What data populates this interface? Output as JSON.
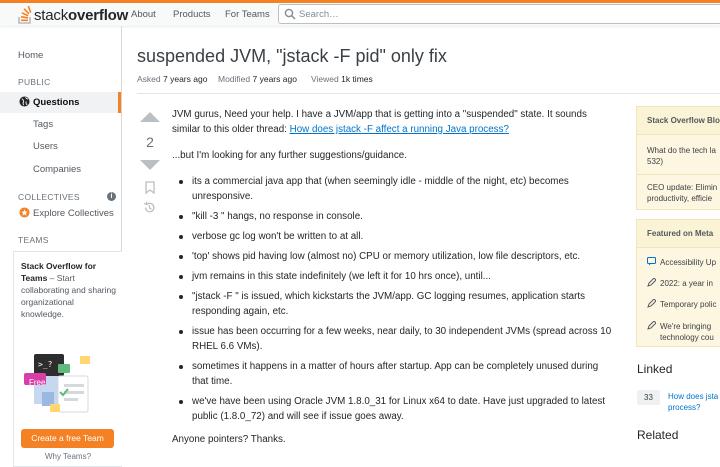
{
  "header": {
    "logo_plain": "stack",
    "logo_bold": "overflow",
    "nav": [
      "About",
      "Products",
      "For Teams"
    ],
    "search_placeholder": "Search…"
  },
  "sidebar": {
    "home": "Home",
    "public_heading": "PUBLIC",
    "questions": "Questions",
    "tags": "Tags",
    "users": "Users",
    "companies": "Companies",
    "collectives_heading": "COLLECTIVES",
    "explore_collectives": "Explore Collectives",
    "teams_heading": "TEAMS",
    "teams_card": {
      "title": "Stack Overflow for Teams",
      "desc": " – Start collaborating and sharing organizational knowledge.",
      "badge": "Free",
      "button": "Create a free Team",
      "why": "Why Teams?"
    }
  },
  "question": {
    "title": "suspended JVM, \"jstack -F pid\" only fix",
    "asked_label": "Asked",
    "asked_value": "7 years ago",
    "modified_label": "Modified",
    "modified_value": "7 years ago",
    "viewed_label": "Viewed",
    "viewed_value": "1k times",
    "votes": "2",
    "intro": "JVM gurus, Need your help. I have a JVM/app that is getting into a \"suspended\" state. It sounds similar to this older thread: ",
    "intro_link": "How does jstack -F affect a running Java process?",
    "followup": "...but I'm looking for any further suggestions/guidance.",
    "bullets": [
      "its a commercial java app that (when seemingly idle - middle of the night, etc) becomes unresponsive.",
      "\"kill -3 \" hangs, no response in console.",
      "verbose gc log won't be written to at all.",
      "'top' shows pid having low (almost no) CPU or memory utilization, low file descriptors, etc.",
      "jvm remains in this state indefinitely (we left it for 10 hrs once), until...",
      "\"jstack -F \" is issued, which kickstarts the JVM/app. GC logging resumes, application starts responding again, etc.",
      "issue has been occurring for a few weeks, near daily, to 30 independent JVMs (spread across 10 RHEL 6.6 VMs).",
      "sometimes it happens in a matter of hours after startup. App can be completely unused during that time.",
      "we've have been using Oracle JVM 1.8.0_31 for Linux x64 to date. Have just upgraded to latest public (1.8.0_72) and will see if issue goes away."
    ],
    "closing": "Anyone pointers? Thanks."
  },
  "right": {
    "blog_heading": "Stack Overflow Blog",
    "blog_items": [
      "What do the tech la",
      "532)",
      "CEO update: Elimin",
      "productivity, efficie"
    ],
    "meta_heading": "Featured on Meta",
    "meta_items": [
      "Accessibility Up",
      "2022: a year in",
      "Temporary polic",
      "We're bringing",
      "technology cou"
    ],
    "linked_heading": "Linked",
    "linked_count": "33",
    "linked_line1": "How does jsta",
    "linked_line2": "process?",
    "related_heading": "Related"
  },
  "colors": {
    "accent": "#f48225",
    "link": "#0074cc",
    "sidebar_box": "#fdf7e2"
  }
}
